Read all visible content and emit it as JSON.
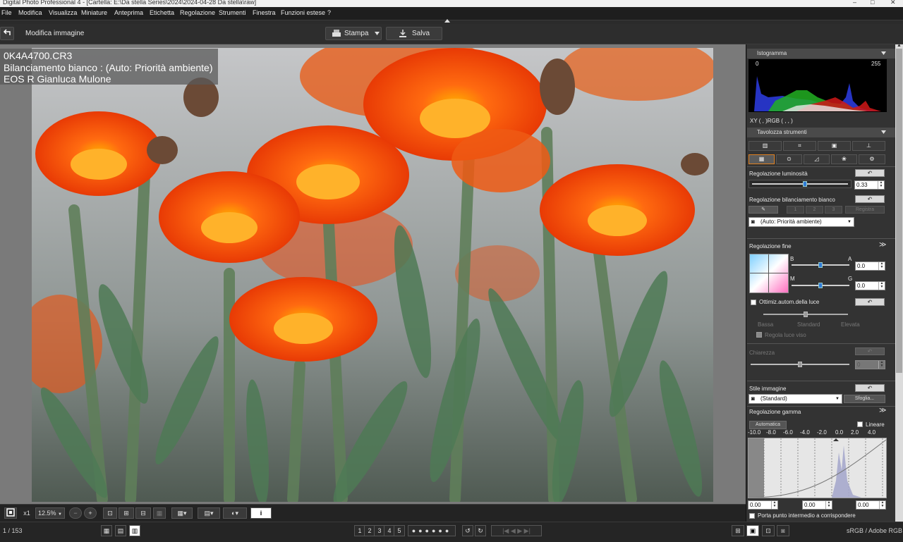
{
  "window": {
    "title": "Digital Photo Professional 4 - [Cartella: E:\\Da stella Series\\2024\\2024-04-28 Da stella\\raw]",
    "controls": [
      "–",
      "□",
      "✕"
    ]
  },
  "menu": [
    "File",
    "Modifica",
    "Visualizza",
    "Miniature",
    "Anteprima",
    "Etichetta",
    "Regolazione",
    "Strumenti",
    "Finestra",
    "Funzioni estese",
    "?"
  ],
  "toolbar": {
    "back_icon": "back-arrow-icon",
    "section_title": "Modifica immagine",
    "print_label": "Stampa",
    "save_label": "Salva"
  },
  "overlay": {
    "filename": "0K4A4700.CR3",
    "white_balance": "Bilanciamento bianco : (Auto: Priorità ambiente)",
    "camera_owner": "EOS R Gianluca Mulone"
  },
  "viewbar": {
    "fit_icon": "fit-screen-icon",
    "zoom_x1": "x1",
    "zoom_value": "12.5%",
    "zoom_out_icon": "zoom-out-icon",
    "zoom_in_icon": "zoom-in-icon",
    "info_label": "i"
  },
  "statusbar": {
    "image_counter": "1 / 153",
    "ratings": [
      "1",
      "2",
      "3",
      "4",
      "5"
    ],
    "color_space": "sRGB / Adobe RGB"
  },
  "panel": {
    "histogram": {
      "title": "Istogramma",
      "min_label": "0",
      "max_label": "255",
      "readout": "XY (   ,   )RGB (   ,   ,   )"
    },
    "toolbox": {
      "title": "Tavolozza strumenti",
      "tool_icons": [
        "basic-adjust-icon",
        "crop-icon",
        "lens-correction-icon",
        "stamp-icon"
      ],
      "tab_icons": [
        "basic-tab-icon",
        "detail-tab-icon",
        "tone-curve-tab-icon",
        "color-tab-icon",
        "settings-tab-icon"
      ]
    },
    "brightness": {
      "label": "Regolazione luminosità",
      "value": "0.33",
      "level": 0.55
    },
    "white_balance": {
      "label": "Regolazione bilanciamento bianco",
      "custom_buttons": [
        "1",
        "2",
        "3"
      ],
      "register_label": "Registra",
      "preset": "(Auto: Priorità ambiente)"
    },
    "fine_tune": {
      "label": "Regolazione fine",
      "b_label": "B",
      "a_label": "A",
      "m_label": "M",
      "g_label": "G",
      "ba_value": "0.0",
      "mg_value": "0.0"
    },
    "auto_lighting": {
      "label": "Ottimiz.autom.della luce",
      "levels": [
        "Bassa",
        "Standard",
        "Elevata"
      ],
      "highlight_label": "Regola luce viso"
    },
    "clarity": {
      "label": "Chiarezza",
      "value": "0"
    },
    "picture_style": {
      "label": "Stile immagine",
      "value": "(Standard)",
      "browse_label": "Sfoglia..."
    },
    "gamma": {
      "label": "Regolazione gamma",
      "auto_label": "Automatica",
      "linear_label": "Lineare",
      "scale": [
        "-10.0",
        "-8.0",
        "-6.0",
        "-4.0",
        "-2.0",
        "0.0",
        "2.0",
        "4.0"
      ],
      "left_value": "0.00",
      "mid_value": "0.00",
      "right_value": "0.00",
      "midpoint_label": "Porta punto intermedio a corrispondere"
    }
  }
}
